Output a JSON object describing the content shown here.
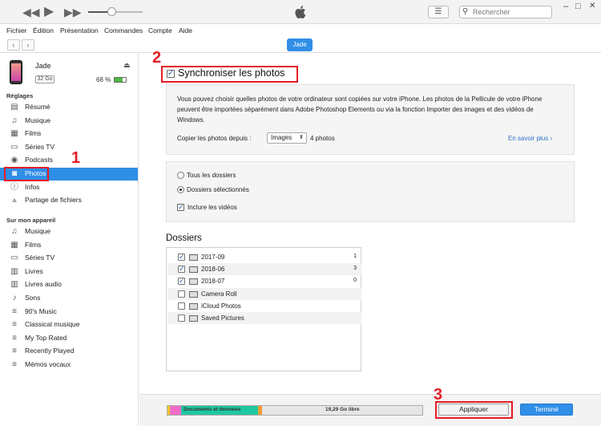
{
  "window": {
    "search_placeholder": "Rechercher",
    "minimize": "–",
    "maximize": "□",
    "close": "✕"
  },
  "menu": [
    "Fichier",
    "Édition",
    "Présentation",
    "Commandes",
    "Compte",
    "Aide"
  ],
  "device": {
    "pill": "Jade",
    "name": "Jade",
    "capacity": "32 Go",
    "battery": "68 %",
    "battery_level": 0.68
  },
  "sidebar": {
    "settings_header": "Réglages",
    "settings_items": [
      {
        "label": "Résumé",
        "icon": "summary-icon"
      },
      {
        "label": "Musique",
        "icon": "music-icon"
      },
      {
        "label": "Films",
        "icon": "film-icon"
      },
      {
        "label": "Séries TV",
        "icon": "tv-icon"
      },
      {
        "label": "Podcasts",
        "icon": "podcast-icon"
      },
      {
        "label": "Photos",
        "icon": "camera-icon",
        "selected": true
      },
      {
        "label": "Infos",
        "icon": "info-icon"
      },
      {
        "label": "Partage de fichiers",
        "icon": "apps-icon"
      }
    ],
    "device_header": "Sur mon appareil",
    "device_items": [
      {
        "label": "Musique",
        "icon": "music-icon"
      },
      {
        "label": "Films",
        "icon": "film-icon"
      },
      {
        "label": "Séries TV",
        "icon": "tv-icon"
      },
      {
        "label": "Livres",
        "icon": "book-icon"
      },
      {
        "label": "Livres audio",
        "icon": "audiobook-icon"
      },
      {
        "label": "Sons",
        "icon": "bell-icon"
      },
      {
        "label": "90's Music",
        "icon": "playlist-icon"
      },
      {
        "label": "Classical musique",
        "icon": "playlist-icon"
      },
      {
        "label": "My Top Rated",
        "icon": "playlist-icon"
      },
      {
        "label": "Recently Played",
        "icon": "playlist-icon"
      },
      {
        "label": "Mémos vocaux",
        "icon": "playlist-icon"
      }
    ]
  },
  "main": {
    "sync_label": "Synchroniser les photos",
    "description": "Vous pouvez choisir quelles photos de votre ordinateur sont copiées sur votre iPhone. Les photos de la Pellicule de votre iPhone peuvent être importées séparément dans Adobe Photoshop Elements ou via la fonction Importer des images et des vidéos de Windows.",
    "copy_from_label": "Copier les photos depuis :",
    "copy_from_value": "Images",
    "photo_count": "4 photos",
    "learn_more": "En savoir plus",
    "option_all": "Tous les dossiers",
    "option_selected": "Dossiers sélectionnés",
    "include_videos": "Inclure les vidéos",
    "folders_title": "Dossiers",
    "folders": [
      {
        "name": "2017-09",
        "count": "1",
        "checked": true
      },
      {
        "name": "2018-06",
        "count": "3",
        "checked": true
      },
      {
        "name": "2018-07",
        "count": "0",
        "checked": true
      },
      {
        "name": "Camera Roll",
        "count": "",
        "checked": false
      },
      {
        "name": "iCloud Photos",
        "count": "",
        "checked": false
      },
      {
        "name": "Saved Pictures",
        "count": "",
        "checked": false
      }
    ]
  },
  "footer": {
    "docs_label": "Documents et données",
    "free_label": "19,29 Go libre",
    "apply": "Appliquer",
    "done": "Terminé"
  },
  "annotations": [
    "1",
    "2",
    "3"
  ],
  "colors": {
    "accent": "#2f8ee6",
    "highlight": "#e51c23",
    "storage_pink": "#f06ec8",
    "storage_yellow": "#f3c823",
    "storage_teal": "#1fc8a0",
    "storage_orange": "#f39b35"
  }
}
